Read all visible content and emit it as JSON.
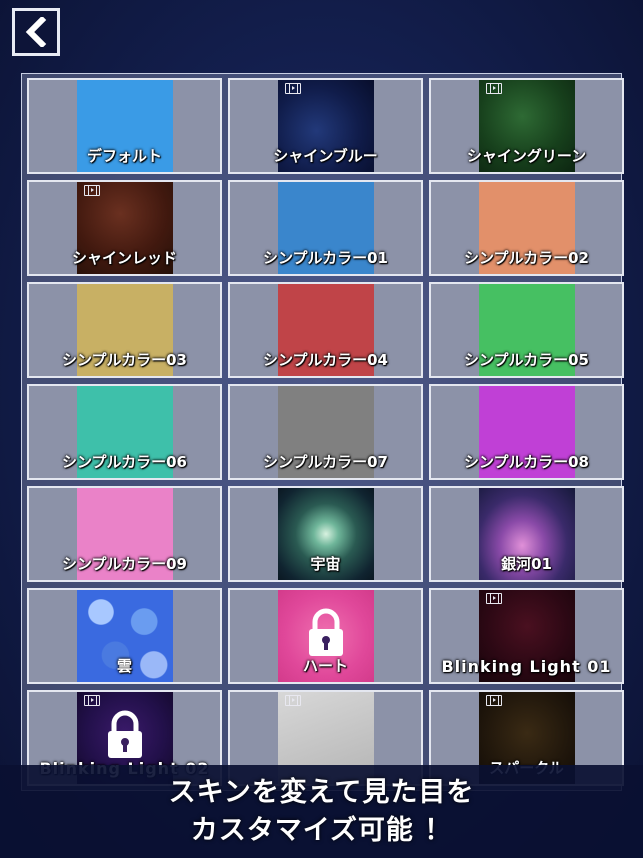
{
  "skins": [
    {
      "label": "デフォルト",
      "bg": "#3a9be6",
      "video": false,
      "locked": false
    },
    {
      "label": "シャインブルー",
      "bg": "radial-gradient(circle at 40% 55%, #22397a 0%, #101c4a 55%, #070d2a 100%)",
      "video": true,
      "locked": false
    },
    {
      "label": "シャイングリーン",
      "bg": "radial-gradient(circle at 45% 40%, #2e6a34 0%, #17401c 55%, #0c2410 100%)",
      "video": true,
      "locked": false
    },
    {
      "label": "シャインレッド",
      "bg": "radial-gradient(circle at 45% 35%, #6a3020 0%, #42190f 55%, #241008 100%)",
      "video": true,
      "locked": false
    },
    {
      "label": "シンプルカラー01",
      "bg": "#3a86cc",
      "video": false,
      "locked": false
    },
    {
      "label": "シンプルカラー02",
      "bg": "#e2906a",
      "video": false,
      "locked": false
    },
    {
      "label": "シンプルカラー03",
      "bg": "#c8b064",
      "video": false,
      "locked": false
    },
    {
      "label": "シンプルカラー04",
      "bg": "#c04448",
      "video": false,
      "locked": false
    },
    {
      "label": "シンプルカラー05",
      "bg": "#46c062",
      "video": false,
      "locked": false
    },
    {
      "label": "シンプルカラー06",
      "bg": "#3ec0aa",
      "video": false,
      "locked": false
    },
    {
      "label": "シンプルカラー07",
      "bg": "#808080",
      "video": false,
      "locked": false
    },
    {
      "label": "シンプルカラー08",
      "bg": "#c040d6",
      "video": false,
      "locked": false
    },
    {
      "label": "シンプルカラー09",
      "bg": "#ea82c8",
      "video": false,
      "locked": false
    },
    {
      "label": "宇宙",
      "bg": "radial-gradient(ellipse at 50% 50%, #d8f2e0 0%, #6fb69a 18%, #2a5a52 45%, #102430 80%, #0a1620 100%)",
      "video": false,
      "locked": false
    },
    {
      "label": "銀河01",
      "bg": "radial-gradient(ellipse at 45% 62%, #e090d8 0%, #8a4aa8 30%, #3a2a6a 60%, #141838 100%)",
      "video": false,
      "locked": false
    },
    {
      "label": "雲",
      "bg": "radial-gradient(circle at 25% 25%, #a8c8ff 0 12%, transparent 13%), radial-gradient(circle at 70% 35%, #6a9cf0 0 14%, transparent 15%), radial-gradient(circle at 40% 70%, #4a7ae0 0 15%, transparent 16%), radial-gradient(circle at 80% 80%, #9ab8f8 0 12%, transparent 13%), #3a6ae0",
      "video": false,
      "locked": false
    },
    {
      "label": "ハート",
      "bg": "radial-gradient(circle at 50% 50%, #f070b0 0%, #e0489a 60%, #d23a8a 100%)",
      "video": false,
      "locked": true
    },
    {
      "label": "Blinking Light 01",
      "bg": "radial-gradient(circle at 50% 40%, #4a1020 0%, #2c0814 55%, #16040a 100%)",
      "video": true,
      "locked": false
    },
    {
      "label": "Blinking Light 02",
      "bg": "radial-gradient(circle at 50% 45%, #3a1a6a 0%, #22104a 55%, #120828 100%)",
      "video": true,
      "locked": true
    },
    {
      "label": "",
      "bg": "linear-gradient(160deg, #d8d8d8 0%, #b4b4b4 100%)",
      "video": true,
      "locked": false
    },
    {
      "label": "スパークル",
      "bg": "radial-gradient(circle at 50% 45%, #3a2a14 0%, #22180c 55%, #100a06 100%)",
      "video": true,
      "locked": false
    }
  ],
  "banner": {
    "line1": "スキンを変えて見た目を",
    "line2": "カスタマイズ可能 ！"
  }
}
